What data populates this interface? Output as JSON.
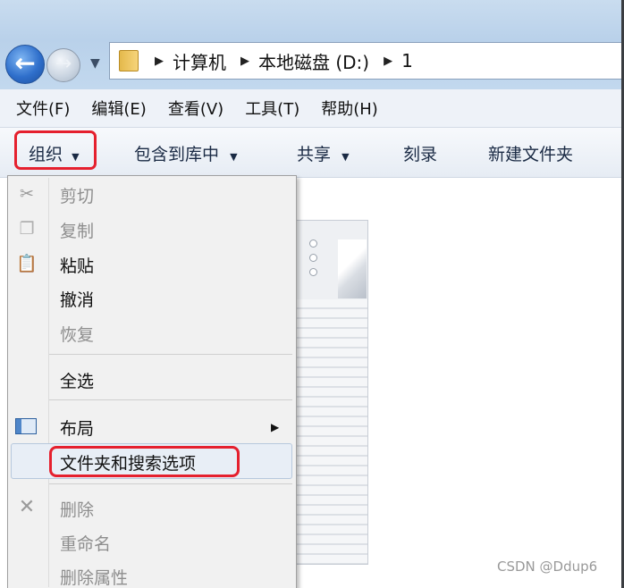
{
  "address": {
    "crumbs": [
      "计算机",
      "本地磁盘 (D:)",
      "1"
    ]
  },
  "menubar": {
    "items": [
      "文件(F)",
      "编辑(E)",
      "查看(V)",
      "工具(T)",
      "帮助(H)"
    ]
  },
  "toolbar": {
    "organize": "组织",
    "include_library": "包含到库中",
    "share": "共享",
    "burn": "刻录",
    "new_folder": "新建文件夹"
  },
  "org_menu": {
    "cut": "剪切",
    "copy": "复制",
    "paste": "粘贴",
    "undo": "撤消",
    "redo": "恢复",
    "select_all": "全选",
    "layout": "布局",
    "folder_options": "文件夹和搜索选项",
    "delete": "删除",
    "rename": "重命名",
    "delete_props": "删除属性"
  },
  "icons": {
    "back": "back-arrow-icon",
    "forward": "forward-arrow-icon",
    "folder": "folder-icon",
    "scissors": "scissors-icon",
    "copy": "copy-icon",
    "paste": "clipboard-icon",
    "layout": "layout-pane-icon",
    "delete": "delete-x-icon"
  },
  "colors": {
    "highlight_border": "#e5202e",
    "disabled_text": "#8e8e8e"
  },
  "watermark": "CSDN @Ddup6"
}
